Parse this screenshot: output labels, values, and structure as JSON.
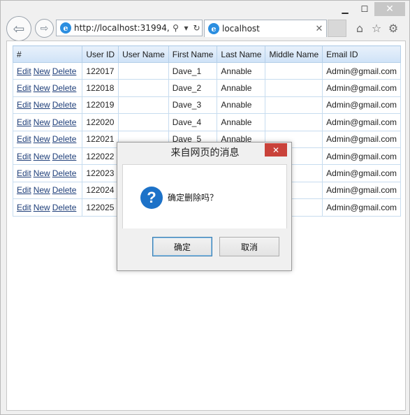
{
  "browser": {
    "address": "http://localhost:31994,",
    "tab_title": "localhost",
    "caption": {
      "minimize": "▁",
      "maximize": "☐",
      "close": "✕"
    },
    "tab_close": "✕"
  },
  "table": {
    "headers": [
      "#",
      "User ID",
      "User Name",
      "First Name",
      "Last Name",
      "Middle Name",
      "Email ID"
    ],
    "actions": {
      "edit": "Edit",
      "new": "New",
      "delete": "Delete"
    },
    "rows": [
      {
        "user_id": "122017",
        "user_name": "",
        "first_name": "Dave_1",
        "last_name": "Annable",
        "middle_name": "",
        "email": "Admin@gmail.com"
      },
      {
        "user_id": "122018",
        "user_name": "",
        "first_name": "Dave_2",
        "last_name": "Annable",
        "middle_name": "",
        "email": "Admin@gmail.com"
      },
      {
        "user_id": "122019",
        "user_name": "",
        "first_name": "Dave_3",
        "last_name": "Annable",
        "middle_name": "",
        "email": "Admin@gmail.com"
      },
      {
        "user_id": "122020",
        "user_name": "",
        "first_name": "Dave_4",
        "last_name": "Annable",
        "middle_name": "",
        "email": "Admin@gmail.com"
      },
      {
        "user_id": "122021",
        "user_name": "",
        "first_name": "Dave_5",
        "last_name": "Annable",
        "middle_name": "",
        "email": "Admin@gmail.com"
      },
      {
        "user_id": "122022",
        "user_name": "",
        "first_name": "",
        "last_name": "",
        "middle_name": "",
        "email": "Admin@gmail.com"
      },
      {
        "user_id": "122023",
        "user_name": "",
        "first_name": "",
        "last_name": "",
        "middle_name": "",
        "email": "Admin@gmail.com"
      },
      {
        "user_id": "122024",
        "user_name": "",
        "first_name": "",
        "last_name": "",
        "middle_name": "",
        "email": "Admin@gmail.com"
      },
      {
        "user_id": "122025",
        "user_name": "",
        "first_name": "",
        "last_name": "",
        "middle_name": "",
        "email": "Admin@gmail.com"
      }
    ]
  },
  "dialog": {
    "title": "来自网页的消息",
    "close": "✕",
    "message": "确定删除吗？",
    "ok_label": "确定",
    "cancel_label": "取消",
    "icon": "question-icon"
  },
  "colors": {
    "header_bg": "#d6e7f8",
    "link": "#1f3f7a",
    "dialog_close": "#c9423a",
    "question_icon": "#1d72c8"
  }
}
